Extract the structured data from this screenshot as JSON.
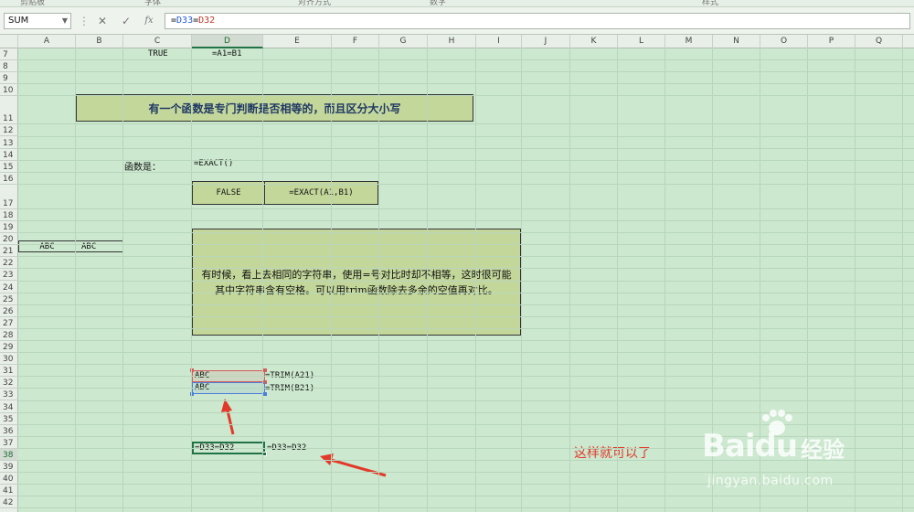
{
  "ribbon": {
    "groups": [
      "剪贴板",
      "字体",
      "对齐方式",
      "数字",
      "样式"
    ]
  },
  "formula_bar": {
    "name_box": "SUM",
    "cancel_icon": "✕",
    "confirm_icon": "✓",
    "fx_label": "fx",
    "formula_parts": [
      {
        "text": "=",
        "kind": "plain"
      },
      {
        "text": "D33",
        "kind": "ref-a"
      },
      {
        "text": "=",
        "kind": "plain"
      },
      {
        "text": "D32",
        "kind": "ref-b"
      }
    ]
  },
  "columns": [
    "A",
    "B",
    "C",
    "D",
    "E",
    "F",
    "G",
    "H",
    "I",
    "J",
    "K",
    "L",
    "M",
    "N",
    "O",
    "P",
    "Q"
  ],
  "active_column": "D",
  "rows": [
    "7",
    "8",
    "9",
    "10",
    "11",
    "12",
    "13",
    "14",
    "15",
    "16",
    "17",
    "18",
    "19",
    "20",
    "21",
    "22",
    "23",
    "24",
    "25",
    "26",
    "27",
    "28",
    "29",
    "30",
    "31",
    "32",
    "33",
    "34",
    "35",
    "36",
    "37",
    "38",
    "39",
    "40",
    "41",
    "42"
  ],
  "active_row": "38",
  "cells": {
    "c7": "TRUE",
    "d7": "=A1=B1",
    "c15": "函数是：",
    "d15": "=EXACT()",
    "a21": "ABC",
    "b21": "ABC",
    "d32": "ABC",
    "e32": "=TRIM(A21)",
    "d33": "ABC",
    "e33": "=TRIM(B21)",
    "d38": "=D33=D32",
    "e38": "=D33=D32"
  },
  "boxes": {
    "title": "有一个函数是专门判断是否相等的，而且区分大小写",
    "false_value": "FALSE",
    "exact_formula": "=EXACT(A1,B1)",
    "note": "有时候，看上去相同的字符串，使用=号对比时却不相等，这时很可能其中字符串含有空格。可以用trim函数除去多余的空值再对比。"
  },
  "annotation": "这样就可以了",
  "watermark": {
    "brand": "Bai",
    "brand_suffix": "du",
    "jingyan": "经验",
    "url": "jingyan.baidu.com"
  },
  "colors": {
    "grid_bg": "#cce8cf",
    "box_fill": "#c4d79b",
    "title_text": "#1f3864",
    "annotation": "#e23a2a",
    "selection": "#217346",
    "ref_red": "#d65b5b",
    "ref_blue": "#4a7ed8"
  }
}
